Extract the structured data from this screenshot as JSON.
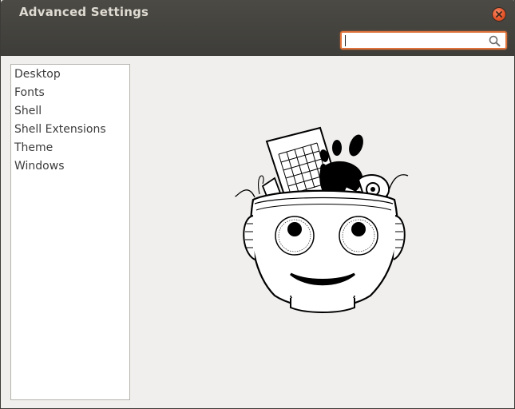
{
  "window": {
    "title": "Advanced Settings"
  },
  "search": {
    "placeholder": "",
    "value": ""
  },
  "sidebar": {
    "items": [
      {
        "label": "Desktop"
      },
      {
        "label": "Fonts"
      },
      {
        "label": "Shell"
      },
      {
        "label": "Shell Extensions"
      },
      {
        "label": "Theme"
      },
      {
        "label": "Windows"
      }
    ]
  },
  "icons": {
    "close": "close-icon",
    "search": "search-icon",
    "illustration": "tweak-tool-head-illustration"
  },
  "colors": {
    "titlebar": "#45443f",
    "close_accent": "#e4552b",
    "search_focus": "#e0733b",
    "background": "#f0efed"
  }
}
